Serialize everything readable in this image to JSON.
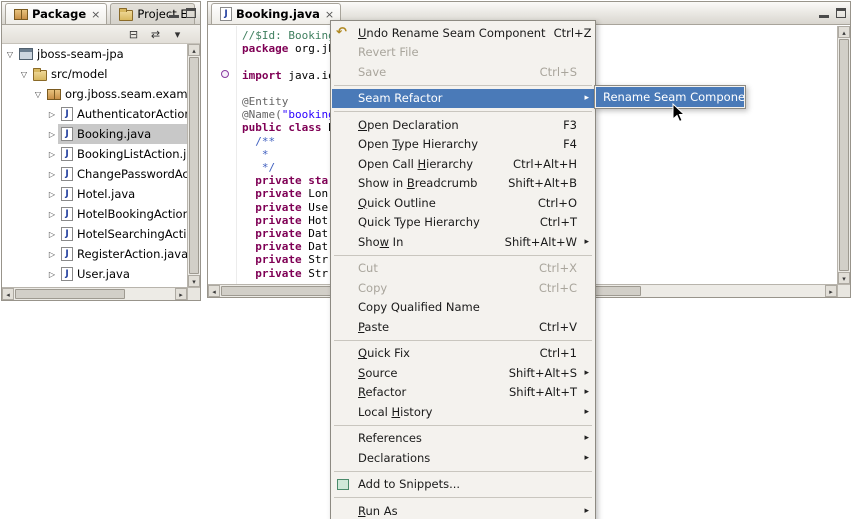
{
  "icons": {
    "close": "×",
    "scroll_up": "▴",
    "scroll_down": "▾",
    "scroll_left": "◂",
    "scroll_right": "▸",
    "expanded": "▽",
    "collapsed": "▷",
    "submenu_arrow": "▸",
    "undo": "↶",
    "java_letter": "J"
  },
  "colors": {
    "menu_highlight": "#4a7ab8",
    "tree_selection": "#c8c8c8",
    "keyword": "#7f0055",
    "string": "#2a00ff",
    "comment": "#3f7f5f",
    "javadoc": "#3f5fbf",
    "annotation": "#646464"
  },
  "explorer": {
    "tabs": [
      {
        "label": "Package"
      },
      {
        "label": "Project E"
      }
    ],
    "toolbar": [
      {
        "name": "collapse-all",
        "glyph": "⊟"
      },
      {
        "name": "link-with-editor",
        "glyph": "⇄"
      },
      {
        "name": "view-menu",
        "glyph": "▾"
      }
    ],
    "tree": [
      {
        "label": "jboss-seam-jpa",
        "depth": 0,
        "state": "expanded",
        "icon": "project"
      },
      {
        "label": "src/model",
        "depth": 1,
        "state": "expanded",
        "icon": "srcfolder"
      },
      {
        "label": "org.jboss.seam.example",
        "depth": 2,
        "state": "expanded",
        "icon": "package"
      },
      {
        "label": "AuthenticatorAction.ja",
        "depth": 3,
        "state": "collapsed",
        "icon": "java"
      },
      {
        "label": "Booking.java",
        "depth": 3,
        "state": "collapsed",
        "icon": "java",
        "selected": true
      },
      {
        "label": "BookingListAction.jav",
        "depth": 3,
        "state": "collapsed",
        "icon": "java"
      },
      {
        "label": "ChangePasswordActio",
        "depth": 3,
        "state": "collapsed",
        "icon": "java"
      },
      {
        "label": "Hotel.java",
        "depth": 3,
        "state": "collapsed",
        "icon": "java"
      },
      {
        "label": "HotelBookingAction.ja",
        "depth": 3,
        "state": "collapsed",
        "icon": "java"
      },
      {
        "label": "HotelSearchingAction",
        "depth": 3,
        "state": "collapsed",
        "icon": "java"
      },
      {
        "label": "RegisterAction.java",
        "depth": 3,
        "state": "collapsed",
        "icon": "java"
      },
      {
        "label": "User.java",
        "depth": 3,
        "state": "collapsed",
        "icon": "java"
      }
    ]
  },
  "editor": {
    "tab": {
      "label": "Booking.java"
    },
    "code": [
      {
        "seg": [
          {
            "t": "//$Id: Booking.j",
            "c": "comment"
          }
        ]
      },
      {
        "seg": [
          {
            "t": "package",
            "c": "kw"
          },
          {
            "t": " org.jbo",
            "c": "plain"
          }
        ]
      },
      {
        "seg": []
      },
      {
        "seg": [
          {
            "t": "import",
            "c": "kw"
          },
          {
            "t": " java.io.",
            "c": "plain"
          }
        ]
      },
      {
        "seg": []
      },
      {
        "seg": [
          {
            "t": "@Entity",
            "c": "ann"
          }
        ]
      },
      {
        "seg": [
          {
            "t": "@Name(",
            "c": "ann"
          },
          {
            "t": "\"booking\"",
            "c": "str"
          }
        ]
      },
      {
        "seg": [
          {
            "t": "public",
            "c": "kw"
          },
          {
            "t": " ",
            "c": "plain"
          },
          {
            "t": "class",
            "c": "kw"
          },
          {
            "t": " Bo",
            "c": "plain"
          }
        ]
      },
      {
        "seg": [
          {
            "t": "  /**",
            "c": "jdoc"
          }
        ]
      },
      {
        "seg": [
          {
            "t": "   *",
            "c": "jdoc"
          }
        ]
      },
      {
        "seg": [
          {
            "t": "   */",
            "c": "jdoc"
          }
        ]
      },
      {
        "seg": [
          {
            "t": "  ",
            "c": "plain"
          },
          {
            "t": "private sta",
            "c": "kw"
          }
        ]
      },
      {
        "seg": [
          {
            "t": "  ",
            "c": "plain"
          },
          {
            "t": "private",
            "c": "kw"
          },
          {
            "t": " Lon",
            "c": "plain"
          }
        ]
      },
      {
        "seg": [
          {
            "t": "  ",
            "c": "plain"
          },
          {
            "t": "private",
            "c": "kw"
          },
          {
            "t": " Use",
            "c": "plain"
          }
        ]
      },
      {
        "seg": [
          {
            "t": "  ",
            "c": "plain"
          },
          {
            "t": "private",
            "c": "kw"
          },
          {
            "t": " Hot",
            "c": "plain"
          }
        ]
      },
      {
        "seg": [
          {
            "t": "  ",
            "c": "plain"
          },
          {
            "t": "private",
            "c": "kw"
          },
          {
            "t": " Dat",
            "c": "plain"
          }
        ]
      },
      {
        "seg": [
          {
            "t": "  ",
            "c": "plain"
          },
          {
            "t": "private",
            "c": "kw"
          },
          {
            "t": " Dat",
            "c": "plain"
          }
        ]
      },
      {
        "seg": [
          {
            "t": "  ",
            "c": "plain"
          },
          {
            "t": "private",
            "c": "kw"
          },
          {
            "t": " Str",
            "c": "plain"
          }
        ]
      },
      {
        "seg": [
          {
            "t": "  ",
            "c": "plain"
          },
          {
            "t": "private",
            "c": "kw"
          },
          {
            "t": " Str",
            "c": "plain"
          }
        ]
      }
    ]
  },
  "menu": {
    "items": [
      {
        "label": "Undo Rename Seam Component",
        "shortcut": "Ctrl+Z",
        "mnemonic": "U",
        "icon": "undo"
      },
      {
        "label": "Revert File",
        "disabled": true
      },
      {
        "label": "Save",
        "shortcut": "Ctrl+S",
        "disabled": true
      },
      {
        "sep": true
      },
      {
        "label": "Seam Refactor",
        "submenu": true,
        "highlighted": true
      },
      {
        "sep": true
      },
      {
        "label": "Open Declaration",
        "shortcut": "F3",
        "mnemonic": "O"
      },
      {
        "label": "Open Type Hierarchy",
        "shortcut": "F4",
        "mnemonic": "T"
      },
      {
        "label": "Open Call Hierarchy",
        "shortcut": "Ctrl+Alt+H",
        "mnemonic": "H"
      },
      {
        "label": "Show in Breadcrumb",
        "shortcut": "Shift+Alt+B",
        "mnemonic": "B"
      },
      {
        "label": "Quick Outline",
        "shortcut": "Ctrl+O",
        "mnemonic": "Q"
      },
      {
        "label": "Quick Type Hierarchy",
        "shortcut": "Ctrl+T"
      },
      {
        "label": "Show In",
        "shortcut": "Shift+Alt+W",
        "mnemonic": "w",
        "submenu": true
      },
      {
        "sep": true
      },
      {
        "label": "Cut",
        "shortcut": "Ctrl+X",
        "disabled": true
      },
      {
        "label": "Copy",
        "shortcut": "Ctrl+C",
        "disabled": true
      },
      {
        "label": "Copy Qualified Name"
      },
      {
        "label": "Paste",
        "shortcut": "Ctrl+V",
        "mnemonic": "P"
      },
      {
        "sep": true
      },
      {
        "label": "Quick Fix",
        "shortcut": "Ctrl+1",
        "mnemonic": "Q"
      },
      {
        "label": "Source",
        "shortcut": "Shift+Alt+S",
        "mnemonic": "S",
        "submenu": true
      },
      {
        "label": "Refactor",
        "shortcut": "Shift+Alt+T",
        "mnemonic": "R",
        "submenu": true
      },
      {
        "label": "Local History",
        "mnemonic": "H",
        "submenu": true
      },
      {
        "sep": true
      },
      {
        "label": "References",
        "submenu": true
      },
      {
        "label": "Declarations",
        "submenu": true
      },
      {
        "sep": true
      },
      {
        "label": "Add to Snippets...",
        "icon": "snippets"
      },
      {
        "sep": true
      },
      {
        "label": "Run As",
        "mnemonic": "R",
        "submenu": true
      }
    ],
    "submenu": [
      {
        "label": "Rename Seam Component",
        "highlighted": true
      }
    ]
  }
}
